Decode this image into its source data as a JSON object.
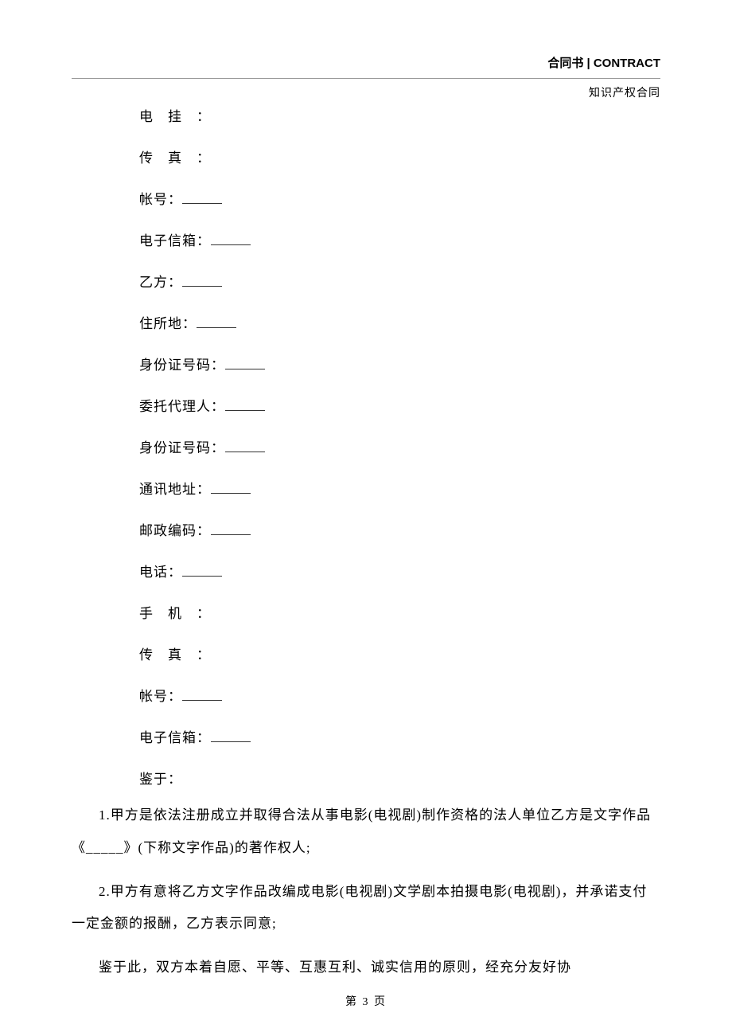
{
  "header": {
    "title": "合同书 | CONTRACT",
    "subtitle": "知识产权合同"
  },
  "fields": [
    {
      "label": "电　挂　：",
      "blank": false
    },
    {
      "label": "传　真　：",
      "blank": false
    },
    {
      "label": "帐号：",
      "blank": true
    },
    {
      "label": "电子信箱：",
      "blank": true
    },
    {
      "label": "乙方：",
      "blank": true
    },
    {
      "label": "住所地：",
      "blank": true
    },
    {
      "label": "身份证号码：",
      "blank": true
    },
    {
      "label": "委托代理人：",
      "blank": true
    },
    {
      "label": "身份证号码：",
      "blank": true
    },
    {
      "label": "通讯地址：",
      "blank": true
    },
    {
      "label": "邮政编码：",
      "blank": true
    },
    {
      "label": "电话：",
      "blank": true
    },
    {
      "label": "手　机　：",
      "blank": false
    },
    {
      "label": "传　真　：",
      "blank": false
    },
    {
      "label": "帐号：",
      "blank": true
    },
    {
      "label": "电子信箱：",
      "blank": true
    }
  ],
  "jianyu": "鉴于：",
  "paras": [
    "1.甲方是依法注册成立并取得合法从事电影(电视剧)制作资格的法人单位乙方是文字作品《_____》(下称文字作品)的著作权人;",
    "2.甲方有意将乙方文字作品改编成电影(电视剧)文学剧本拍摄电影(电视剧)，并承诺支付一定金额的报酬，乙方表示同意;",
    "鉴于此，双方本着自愿、平等、互惠互利、诚实信用的原则，经充分友好协"
  ],
  "footer": "第 3 页"
}
